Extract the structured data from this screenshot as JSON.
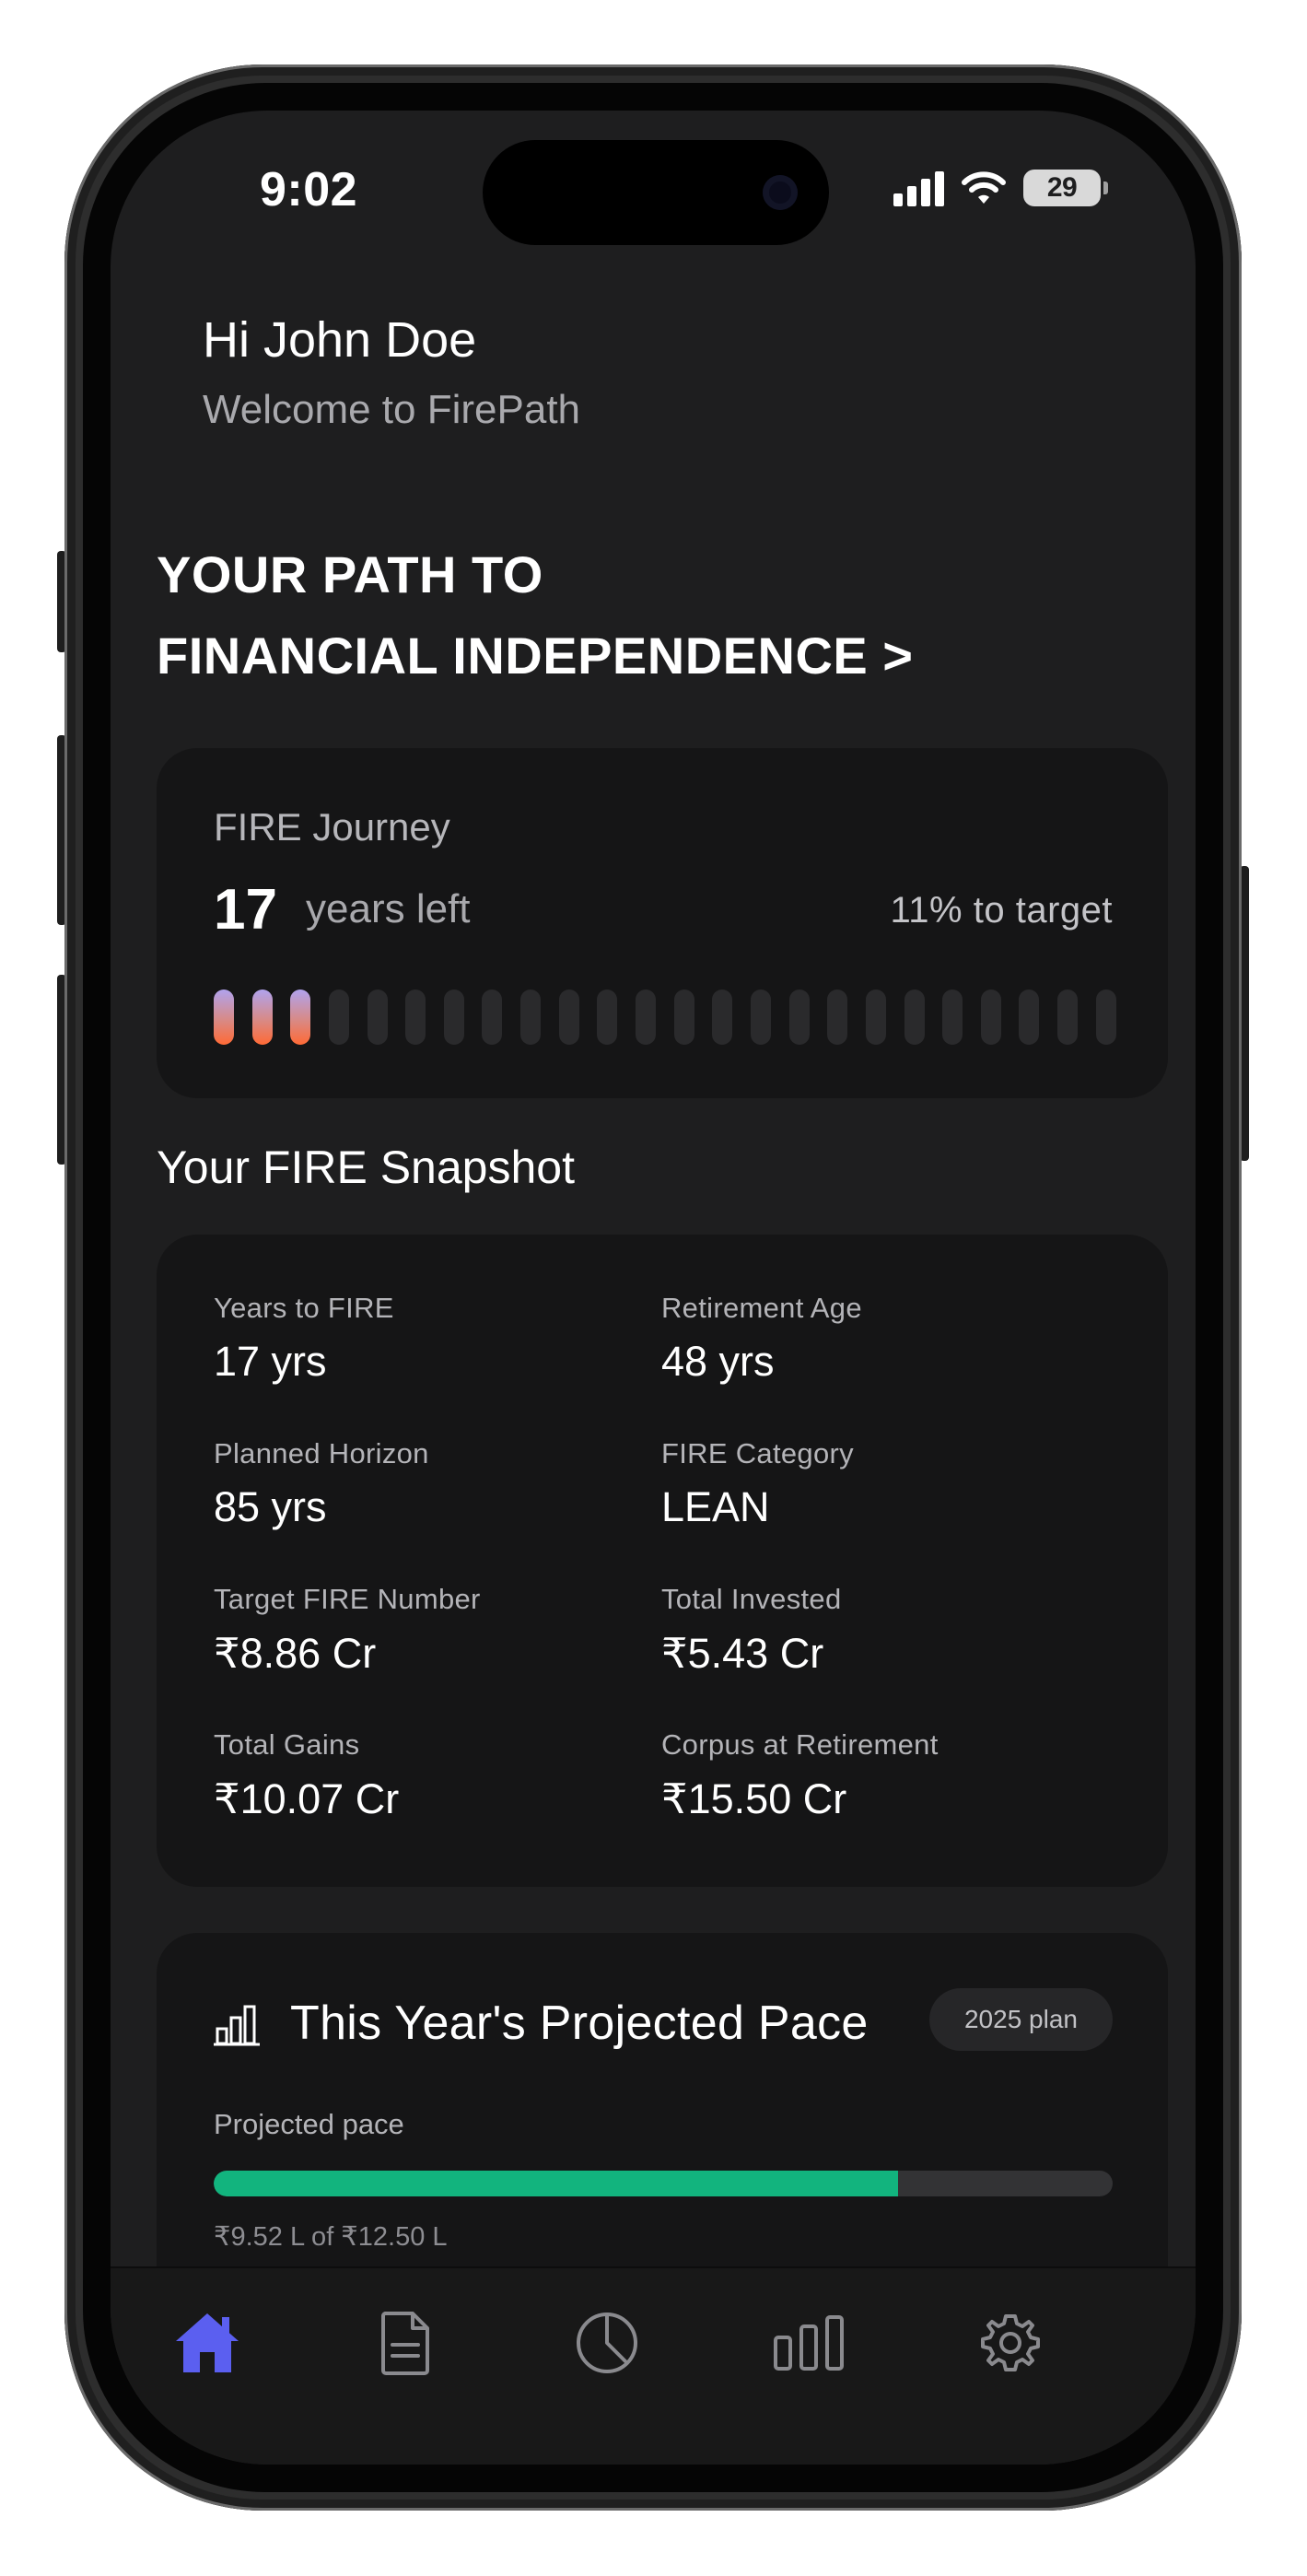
{
  "status_bar": {
    "time": "9:02",
    "battery": "29"
  },
  "greeting": {
    "name": "Hi John Doe",
    "subtitle": "Welcome to FirePath"
  },
  "hero": {
    "line1": "YOUR PATH TO",
    "line2": "FINANCIAL INDEPENDENCE >"
  },
  "journey": {
    "title": "FIRE Journey",
    "years": "17",
    "years_label": "years left",
    "target": "11% to target",
    "segments_total": 24,
    "segments_filled": 3
  },
  "snapshot": {
    "heading": "Your FIRE Snapshot",
    "metrics": [
      {
        "label": "Years to FIRE",
        "value": "17 yrs"
      },
      {
        "label": "Retirement Age",
        "value": "48 yrs"
      },
      {
        "label": "Planned Horizon",
        "value": "85 yrs"
      },
      {
        "label": "FIRE Category",
        "value": "LEAN"
      },
      {
        "label": "Target FIRE Number",
        "value": "₹8.86 Cr"
      },
      {
        "label": "Total Invested",
        "value": "₹5.43 Cr"
      },
      {
        "label": "Total Gains",
        "value": "₹10.07 Cr"
      },
      {
        "label": "Corpus at Retirement",
        "value": "₹15.50 Cr"
      }
    ]
  },
  "pace": {
    "icon": "bar-chart-icon",
    "title": "This Year's Projected Pace",
    "badge": "2025 plan",
    "label": "Projected pace",
    "progress_fraction": 0.7616,
    "amount": "₹9.52 L of ₹12.50 L",
    "accent_color": "#12b47e"
  },
  "tabbar": {
    "items": [
      {
        "icon": "home-icon",
        "active": true
      },
      {
        "icon": "document-icon",
        "active": false
      },
      {
        "icon": "pie-chart-icon",
        "active": false
      },
      {
        "icon": "bar-chart-icon",
        "active": false
      },
      {
        "icon": "settings-icon",
        "active": false
      }
    ],
    "active_color": "#5b5ff0",
    "inactive_color": "#8a8a8e"
  }
}
